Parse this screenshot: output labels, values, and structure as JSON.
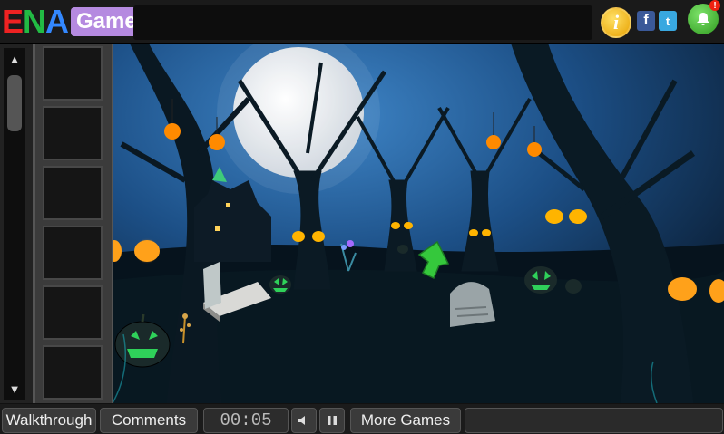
{
  "header": {
    "logo_ena_1": "E",
    "logo_ena_2": "N",
    "logo_ena_3": "A",
    "logo_games": "Games",
    "info_label": "i",
    "facebook_label": "f",
    "twitter_label": "t",
    "notification_badge": "!"
  },
  "inventory": {
    "scroll_up": "▲",
    "scroll_down": "▼"
  },
  "footer": {
    "walkthrough": "Walkthrough",
    "comments": "Comments",
    "timer": "00:05",
    "more_games": "More Games"
  },
  "colors": {
    "moon": "#e6e9ee",
    "pumpkin": "#ffa11a",
    "jack_o_lantern_glow": "#2fd15a",
    "arrow_green": "#35c83c"
  }
}
